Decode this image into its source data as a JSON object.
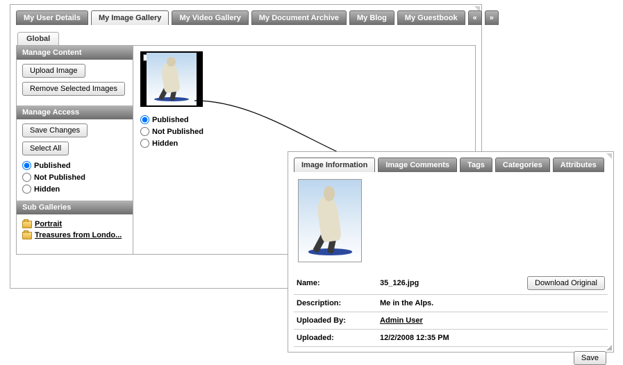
{
  "main_tabs": {
    "t0": "My User Details",
    "t1": "My Image Gallery",
    "t2": "My Video Gallery",
    "t3": "My Document Archive",
    "t4": "My Blog",
    "t5": "My Guestbook",
    "prev": "«",
    "next": "»"
  },
  "subtab": {
    "label": "Global"
  },
  "sidebar": {
    "hdr_manage_content": "Manage Content",
    "btn_upload": "Upload Image",
    "btn_remove": "Remove Selected Images",
    "hdr_manage_access": "Manage Access",
    "btn_save": "Save Changes",
    "btn_select_all": "Select All",
    "radio_published": "Published",
    "radio_not_published": "Not Published",
    "radio_hidden": "Hidden",
    "hdr_sub_galleries": "Sub Galleries",
    "link_portrait": "Portrait",
    "link_treasures": "Treasures from Londo..."
  },
  "content": {
    "radio_published": "Published",
    "radio_not_published": "Not Published",
    "radio_hidden": "Hidden"
  },
  "detail_tabs": {
    "t0": "Image Information",
    "t1": "Image Comments",
    "t2": "Tags",
    "t3": "Categories",
    "t4": "Attributes"
  },
  "detail": {
    "name_lbl": "Name:",
    "name_val": "35_126.jpg",
    "download_btn": "Download Original",
    "desc_lbl": "Description:",
    "desc_val": "Me in the Alps.",
    "uploaded_by_lbl": "Uploaded By:",
    "uploaded_by_val": "Admin User",
    "uploaded_lbl": "Uploaded:",
    "uploaded_val": "12/2/2008 12:35 PM",
    "save_btn": "Save"
  }
}
